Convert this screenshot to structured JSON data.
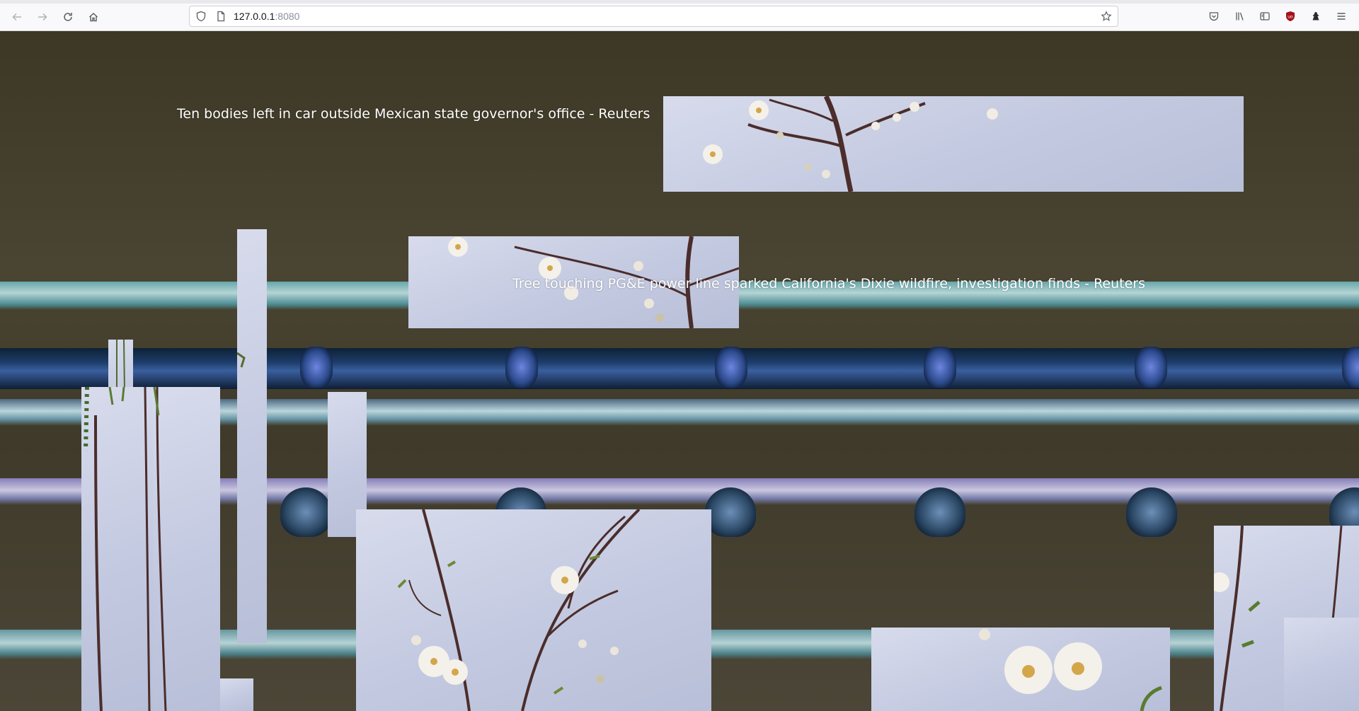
{
  "browser": {
    "url_host": "127.0.0.1",
    "url_port": ":8080",
    "icons": {
      "back": "arrow-left-icon",
      "forward": "arrow-right-icon",
      "reload": "reload-icon",
      "home": "home-icon",
      "shield": "tracking-protection-shield-icon",
      "page": "page-info-icon",
      "bookmark": "star-icon",
      "pocket": "pocket-icon",
      "library": "library-icon",
      "sidebar": "sidebar-icon",
      "extension1": "ublock-origin-icon",
      "extension2": "extension-icon",
      "menu": "hamburger-menu-icon"
    }
  },
  "headlines": [
    {
      "text": "Ten bodies left in car outside Mexican state governor's office - Reuters"
    },
    {
      "text": "Tree touching PG&E power line sparked California's Dixie wildfire, investigation finds - Reuters"
    }
  ],
  "colors": {
    "background": "#3d3825",
    "headline": "#ffffff",
    "photo_sky": "#c8cde3"
  }
}
